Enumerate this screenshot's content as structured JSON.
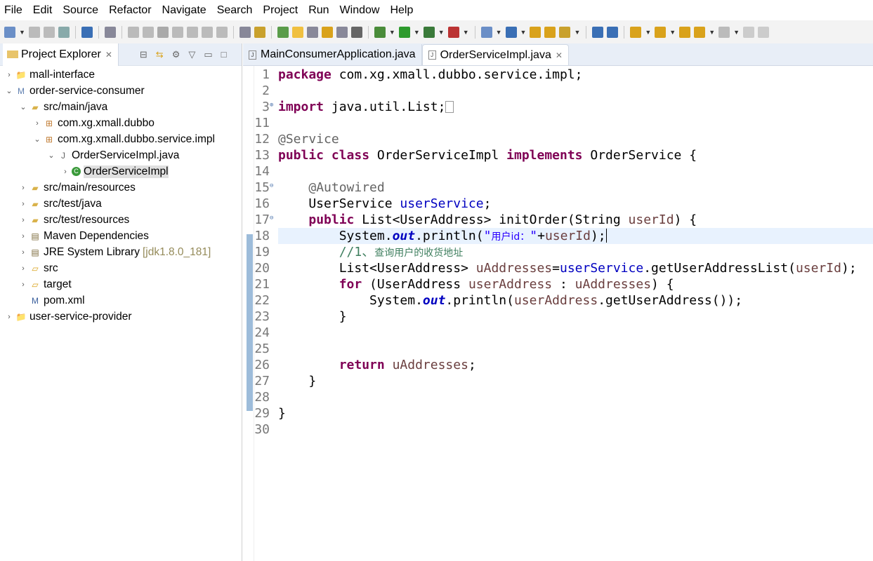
{
  "menu": [
    "File",
    "Edit",
    "Source",
    "Refactor",
    "Navigate",
    "Search",
    "Project",
    "Run",
    "Window",
    "Help"
  ],
  "explorer": {
    "title": "Project Explorer",
    "tree": [
      {
        "label": "mall-interface",
        "depth": 0,
        "twisty": ">",
        "icon": "project-icon"
      },
      {
        "label": "order-service-consumer",
        "depth": 0,
        "twisty": "v",
        "icon": "maven-project-icon"
      },
      {
        "label": "src/main/java",
        "depth": 1,
        "twisty": "v",
        "icon": "source-folder-icon"
      },
      {
        "label": "com.xg.xmall.dubbo",
        "depth": 2,
        "twisty": ">",
        "icon": "package-icon"
      },
      {
        "label": "com.xg.xmall.dubbo.service.impl",
        "depth": 2,
        "twisty": "v",
        "icon": "package-icon"
      },
      {
        "label": "OrderServiceImpl.java",
        "depth": 3,
        "twisty": "v",
        "icon": "java-file-icon"
      },
      {
        "label": "OrderServiceImpl",
        "depth": 4,
        "twisty": ">",
        "icon": "class-icon",
        "selected": true
      },
      {
        "label": "src/main/resources",
        "depth": 1,
        "twisty": ">",
        "icon": "source-folder-icon"
      },
      {
        "label": "src/test/java",
        "depth": 1,
        "twisty": ">",
        "icon": "source-folder-icon"
      },
      {
        "label": "src/test/resources",
        "depth": 1,
        "twisty": ">",
        "icon": "source-folder-icon"
      },
      {
        "label": "Maven Dependencies",
        "depth": 1,
        "twisty": ">",
        "icon": "library-icon"
      },
      {
        "label": "JRE System Library",
        "depth": 1,
        "twisty": ">",
        "icon": "library-icon",
        "decoration": "[jdk1.8.0_181]"
      },
      {
        "label": "src",
        "depth": 1,
        "twisty": ">",
        "icon": "folder-icon"
      },
      {
        "label": "target",
        "depth": 1,
        "twisty": ">",
        "icon": "folder-icon"
      },
      {
        "label": "pom.xml",
        "depth": 1,
        "twisty": "",
        "icon": "maven-file-icon"
      },
      {
        "label": "user-service-provider",
        "depth": 0,
        "twisty": ">",
        "icon": "project-icon"
      }
    ]
  },
  "editor": {
    "tabs": [
      {
        "label": "MainConsumerApplication.java",
        "active": false
      },
      {
        "label": "OrderServiceImpl.java",
        "active": true
      }
    ],
    "current_line": "18",
    "lines": [
      {
        "n": "1",
        "t": [
          [
            "package",
            "kw"
          ],
          [
            " com.xg.xmall.dubbo.service.impl;",
            ""
          ]
        ]
      },
      {
        "n": "2",
        "t": []
      },
      {
        "n": "3",
        "fold": "+",
        "t": [
          [
            "import",
            "kw"
          ],
          [
            " java.util.List;",
            ""
          ]
        ],
        "collapsed": true
      },
      {
        "n": "11",
        "t": []
      },
      {
        "n": "12",
        "t": [
          [
            "@Service",
            "ann"
          ]
        ]
      },
      {
        "n": "13",
        "t": [
          [
            "public",
            "kw"
          ],
          [
            " ",
            ""
          ],
          [
            "class",
            "kw"
          ],
          [
            " OrderServiceImpl ",
            ""
          ],
          [
            "implements",
            "kw"
          ],
          [
            " OrderService {",
            ""
          ]
        ]
      },
      {
        "n": "14",
        "t": []
      },
      {
        "n": "15",
        "fold": "-",
        "t": [
          [
            "    ",
            ""
          ],
          [
            "@Autowired",
            "ann"
          ]
        ]
      },
      {
        "n": "16",
        "t": [
          [
            "    UserService ",
            ""
          ],
          [
            "userService",
            "fld"
          ],
          [
            ";",
            ""
          ]
        ]
      },
      {
        "n": "17",
        "fold": "-",
        "t": [
          [
            "    ",
            ""
          ],
          [
            "public",
            "kw"
          ],
          [
            " List<UserAddress> initOrder(String ",
            ""
          ],
          [
            "userId",
            "var"
          ],
          [
            ") {",
            ""
          ]
        ]
      },
      {
        "n": "18",
        "t": [
          [
            "        System.",
            ""
          ],
          [
            "out",
            "sfld"
          ],
          [
            ".println(",
            ""
          ],
          [
            "\"",
            "str"
          ],
          [
            "用户id：",
            "str cjk"
          ],
          [
            "\"",
            "str"
          ],
          [
            "+",
            ""
          ],
          [
            "userId",
            "var"
          ],
          [
            ");",
            ""
          ]
        ],
        "caret": true
      },
      {
        "n": "19",
        "t": [
          [
            "        ",
            ""
          ],
          [
            "//1、",
            "cmt"
          ],
          [
            "查询用户的收货地址",
            "cmt cjk"
          ]
        ]
      },
      {
        "n": "20",
        "t": [
          [
            "        List<UserAddress> ",
            ""
          ],
          [
            "uAddresses",
            "var"
          ],
          [
            "=",
            ""
          ],
          [
            "userService",
            "fld"
          ],
          [
            ".getUserAddressList(",
            ""
          ],
          [
            "userId",
            "var"
          ],
          [
            ");",
            ""
          ]
        ]
      },
      {
        "n": "21",
        "t": [
          [
            "        ",
            ""
          ],
          [
            "for",
            "kw"
          ],
          [
            " (UserAddress ",
            ""
          ],
          [
            "userAddress",
            "var"
          ],
          [
            " : ",
            ""
          ],
          [
            "uAddresses",
            "var"
          ],
          [
            ") {",
            ""
          ]
        ]
      },
      {
        "n": "22",
        "t": [
          [
            "            System.",
            ""
          ],
          [
            "out",
            "sfld"
          ],
          [
            ".println(",
            ""
          ],
          [
            "userAddress",
            "var"
          ],
          [
            ".getUserAddress());",
            ""
          ]
        ]
      },
      {
        "n": "23",
        "t": [
          [
            "        }",
            ""
          ]
        ]
      },
      {
        "n": "24",
        "t": []
      },
      {
        "n": "25",
        "t": []
      },
      {
        "n": "26",
        "t": [
          [
            "        ",
            ""
          ],
          [
            "return",
            "kw"
          ],
          [
            " ",
            ""
          ],
          [
            "uAddresses",
            "var"
          ],
          [
            ";",
            ""
          ]
        ]
      },
      {
        "n": "27",
        "t": [
          [
            "    }",
            ""
          ]
        ]
      },
      {
        "n": "28",
        "t": []
      },
      {
        "n": "29",
        "t": [
          [
            "}",
            ""
          ]
        ]
      },
      {
        "n": "30",
        "t": []
      }
    ]
  }
}
